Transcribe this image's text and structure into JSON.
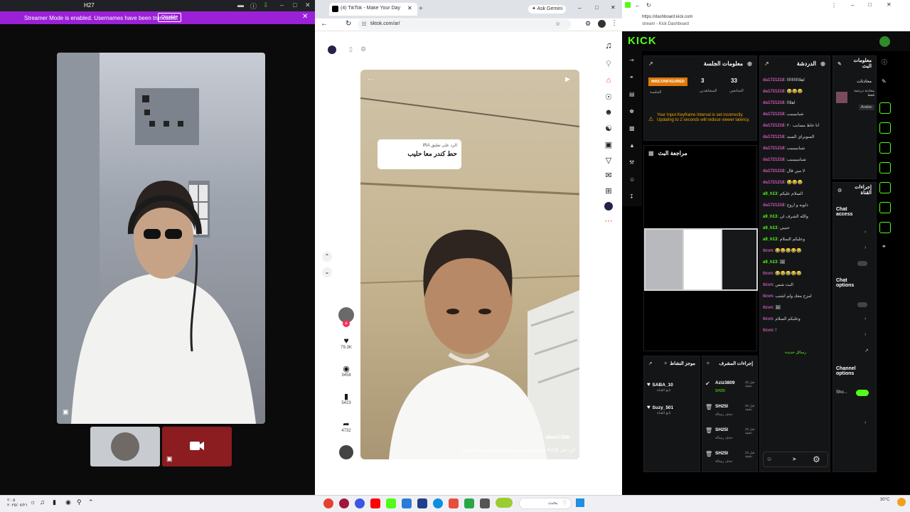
{
  "call": {
    "title": "H27",
    "streamer_banner": "Streamer Mode is enabled. Usernames have been truncated.",
    "disable_label": "Disable"
  },
  "browser": {
    "tab_title": "(4) TikTok - Make Your Day",
    "ask_gemini": "Ask Gemini",
    "url": "tiktok.com/ar/",
    "overlay_line1": "الرد على تعليق IRA",
    "overlay_line2": "حط كندر معا حليب",
    "watermark": "show7396",
    "caption": "الرد على @IRA طعمه شافته مرة حلوة #الوسام #بريده #الوسام",
    "likes": "79.3K",
    "comments": "3458",
    "saves": "5423",
    "shares": "4732"
  },
  "kick": {
    "url": "https://dashboard.kick.com",
    "breadcrumb": "stream - Kick Dashboard",
    "logo": "KICK",
    "session_panel": "معلومات الجلسة",
    "misconfigured": "MISCONFIGURED",
    "session_label": "الجلسة",
    "viewers": "3",
    "viewers_label": "المشاهدين",
    "followers": "33",
    "followers_label": "المتابعين",
    "warning": "Your Input Keyframe Interval is set incorrectly. Updating to 2 seconds will reduce viewer latency.",
    "review_panel": "مراجعة البث",
    "chat_panel": "الدردشة",
    "chat": [
      {
        "user": "da1721218",
        "msg": "اهلااااااااااا",
        "cls": "u"
      },
      {
        "user": "da1721218",
        "msg": "😂😂😂",
        "cls": "u"
      },
      {
        "user": "da1721218",
        "msg": "اهلااا",
        "cls": "u"
      },
      {
        "user": "da1721218",
        "msg": "شبابببببب",
        "cls": "u"
      },
      {
        "user": "da1721218",
        "msg": "انا عاط مسابب ٢٠",
        "cls": "u"
      },
      {
        "user": "da1721218",
        "msg": "السوبراي السبد",
        "cls": "u"
      },
      {
        "user": "da1721218",
        "msg": "شباببببببب",
        "cls": "u"
      },
      {
        "user": "da1721218",
        "msg": "شبابببببببب",
        "cls": "u"
      },
      {
        "user": "da1721218",
        "msg": "لا مين قال",
        "cls": "u"
      },
      {
        "user": "da1721218",
        "msg": "😂😂😂",
        "cls": "u"
      },
      {
        "user": "a9_h13",
        "msg": "السلام عليكم",
        "cls": "g"
      },
      {
        "user": "da1721218",
        "msg": "ذلويه و اروح",
        "cls": "u"
      },
      {
        "user": "a9_h13",
        "msg": "والله الشرف لي",
        "cls": "g"
      },
      {
        "user": "a9_h13",
        "msg": "حبيبي",
        "cls": "g"
      },
      {
        "user": "a9_h13",
        "msg": "وعليكم السلام",
        "cls": "g"
      },
      {
        "user": "ticvn",
        "msg": "😂😂😂😂😂",
        "cls": "u"
      },
      {
        "user": "a9_h13",
        "msg": "🖼",
        "cls": "g"
      },
      {
        "user": "ticvn",
        "msg": "😂😂😂😂😂",
        "cls": "u"
      },
      {
        "user": "ticvn",
        "msg": "البث شس",
        "cls": "u"
      },
      {
        "user": "ticvn",
        "msg": "امزح معك ولم اشتب",
        "cls": "u"
      },
      {
        "user": "ticvn",
        "msg": "🖼",
        "cls": "u"
      },
      {
        "user": "ticvn",
        "msg": "وعليكم السلام",
        "cls": "u"
      },
      {
        "user": "ticvn",
        "msg": "!",
        "cls": "u"
      }
    ],
    "new_messages": "رسائل جديدة",
    "info_panel": "معلومات البث",
    "stream_title": "محادثات",
    "stream_sub": "محادثة دردشة فقط",
    "language": "Arabic",
    "actions_panel": "إجراءات القناة",
    "chat_access": "Chat access",
    "chat_options": "Chat options",
    "channel_options": "Channel options",
    "show_label": "Sho...",
    "mod_actions_panel": "إجراءات المشرف",
    "activity_panel": "موجز النشاط",
    "activity": [
      {
        "name": "SABA_10",
        "sub": "تابع القناة"
      },
      {
        "name": "Suzy_501",
        "sub": "تابع القناة"
      }
    ],
    "mod_actions": [
      {
        "name": "Aziz3809",
        "sub": "SH25I"
      },
      {
        "name": "SH25I",
        "sub": "حذف رسالة"
      },
      {
        "name": "SH25I",
        "sub": "حذف رسالة"
      },
      {
        "name": "SH25I",
        "sub": "حذف رسالة"
      }
    ],
    "mod_time": "قبل 20 دقيقة"
  },
  "taskbar": {
    "search": "بحث",
    "temp": "30°C",
    "time": "٢:٠٥",
    "date": "٢٠٢٥/٠٧/٢١"
  },
  "colors": {
    "kick_green": "#53fc18",
    "streamer_purple": "#9a21d6",
    "tiktok_red": "#fe2c55"
  }
}
